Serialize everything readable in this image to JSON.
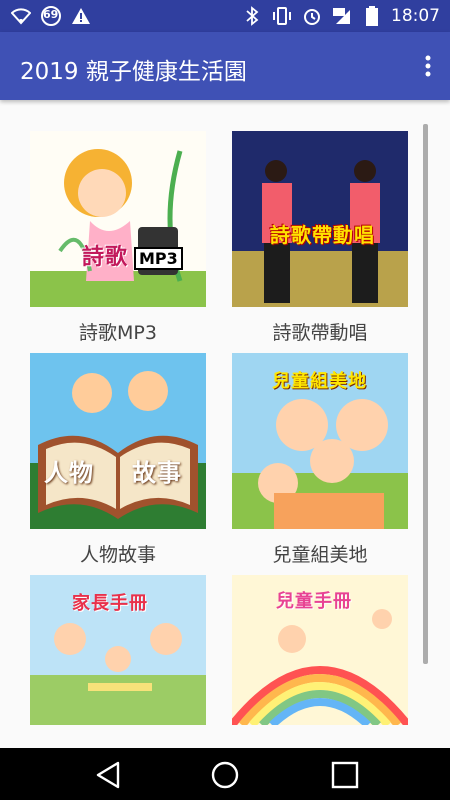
{
  "status": {
    "battery_level": "69",
    "time": "18:07"
  },
  "app": {
    "title": "2019 親子健康生活園"
  },
  "tiles": [
    {
      "label": "詩歌MP3",
      "overlay": "詩歌"
    },
    {
      "label": "詩歌帶動唱",
      "overlay": "詩歌帶動唱"
    },
    {
      "label": "人物故事",
      "overlay_left": "人物",
      "overlay_right": "故事"
    },
    {
      "label": "兒童組美地",
      "overlay": "兒童組美地"
    },
    {
      "label": "",
      "overlay": "家長手冊"
    },
    {
      "label": "",
      "overlay": "兒童手冊"
    }
  ],
  "colors": {
    "status_bar": "#303f9f",
    "app_bar": "#3f51b5",
    "nav_bar": "#000000"
  }
}
